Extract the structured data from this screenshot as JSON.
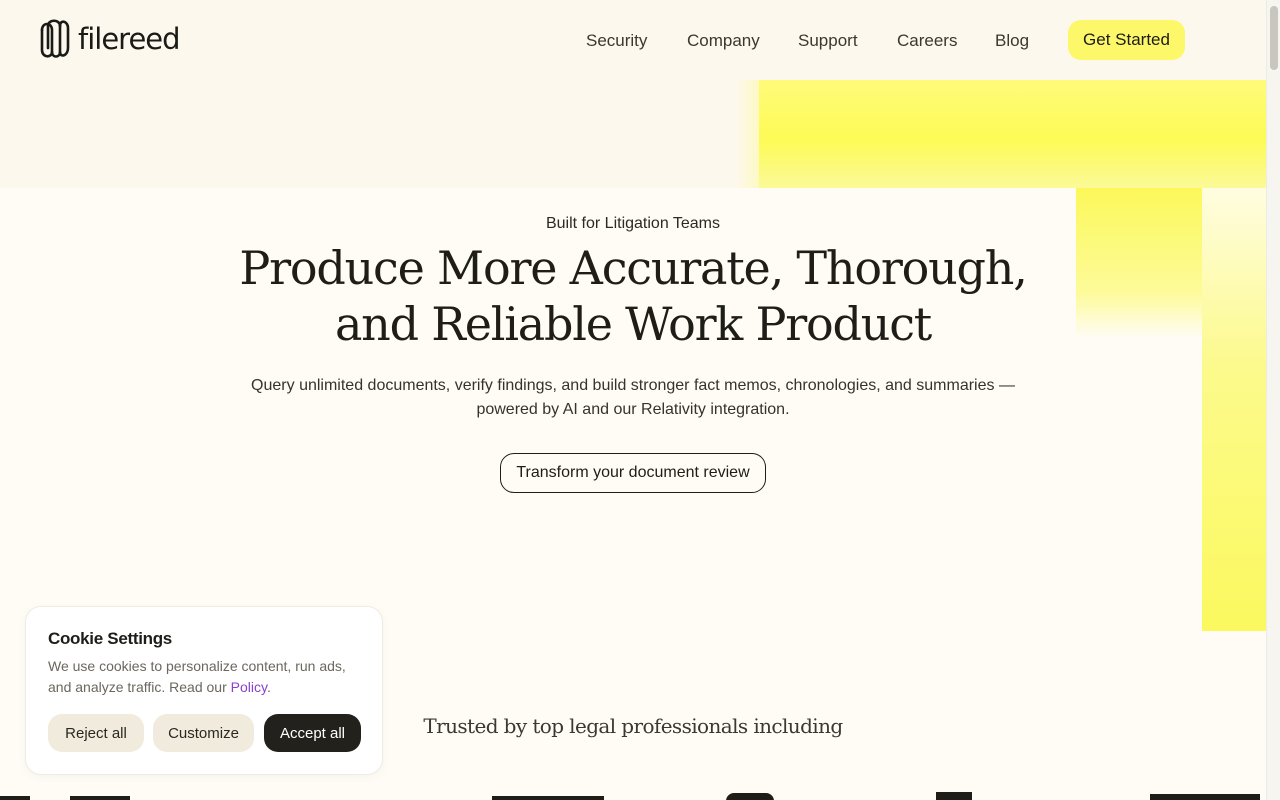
{
  "brand": {
    "name": "filereed",
    "logo_icon": "paperclip-loop-icon"
  },
  "nav": {
    "links": [
      {
        "label": "Security"
      },
      {
        "label": "Company"
      },
      {
        "label": "Support"
      },
      {
        "label": "Careers"
      },
      {
        "label": "Blog"
      }
    ],
    "cta_label": "Get Started"
  },
  "hero": {
    "eyebrow": "Built for Litigation Teams",
    "headline_line1": "Produce More Accurate, Thorough,",
    "headline_line2": "and Reliable Work Product",
    "subhead_line1": "Query unlimited documents, verify findings, and build stronger fact memos, chronologies, and summaries —",
    "subhead_line2": "powered by AI and our Relativity integration.",
    "button_label": "Transform your document review"
  },
  "trusted": {
    "text": "Trusted by top legal professionals including"
  },
  "cookie": {
    "title": "Cookie Settings",
    "text_before_link": "We use cookies to personalize content, run ads, and analyze traffic. Read our ",
    "link_label": "Policy",
    "text_after_link": ".",
    "reject_label": "Reject all",
    "customize_label": "Customize",
    "accept_label": "Accept all"
  },
  "colors": {
    "accent_yellow": "#fdf86a",
    "background": "#fffcf5",
    "text_dark": "#1f1d17",
    "link_purple": "#8a3fd1"
  }
}
